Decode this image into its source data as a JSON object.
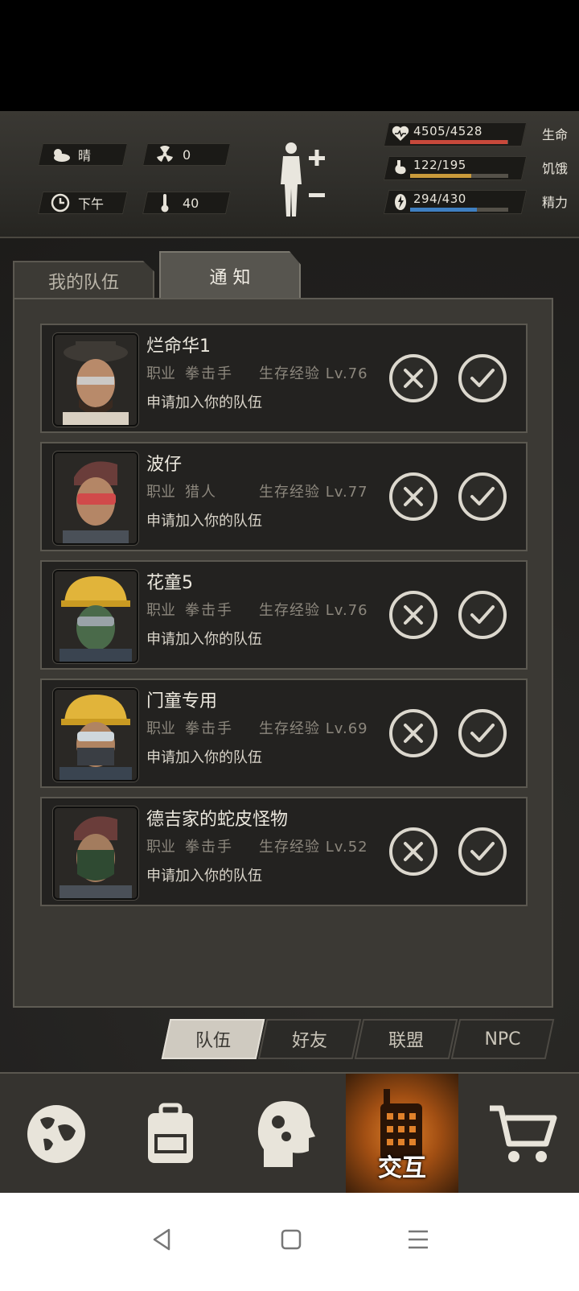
{
  "status": {
    "weather": {
      "icon": "cloud-sun-icon",
      "text": "晴"
    },
    "radiation": {
      "icon": "radiation-icon",
      "text": "0"
    },
    "time": {
      "icon": "clock-icon",
      "text": "下午"
    },
    "temperature": {
      "icon": "thermometer-icon",
      "text": "40"
    },
    "stats": [
      {
        "icon": "heart-icon",
        "text": "4505/4528",
        "label": "生命",
        "fill": 0.995,
        "color": "#c8493b"
      },
      {
        "icon": "stomach-icon",
        "text": "122/195",
        "label": "饥饿",
        "fill": 0.626,
        "color": "#c99a3a"
      },
      {
        "icon": "energy-icon",
        "text": "294/430",
        "label": "精力",
        "fill": 0.684,
        "color": "#3f7fc1"
      }
    ]
  },
  "tabs": [
    {
      "label": "我的队伍",
      "active": false
    },
    {
      "label": "通 知",
      "active": true
    }
  ],
  "job_label": "职业",
  "requests": [
    {
      "name": "烂命华1",
      "job": "拳击手",
      "exp": "生存经验 Lv.76",
      "msg": "申请加入你的队伍"
    },
    {
      "name": "波仔",
      "job": "猎人",
      "exp": "生存经验 Lv.77",
      "msg": "申请加入你的队伍"
    },
    {
      "name": "花童5",
      "job": "拳击手",
      "exp": "生存经验 Lv.76",
      "msg": "申请加入你的队伍"
    },
    {
      "name": "门童专用",
      "job": "拳击手",
      "exp": "生存经验 Lv.69",
      "msg": "申请加入你的队伍"
    },
    {
      "name": "德吉家的蛇皮怪物",
      "job": "拳击手",
      "exp": "生存经验 Lv.52",
      "msg": "申请加入你的队伍"
    }
  ],
  "subtabs": [
    {
      "label": "队伍",
      "active": true
    },
    {
      "label": "好友",
      "active": false
    },
    {
      "label": "联盟",
      "active": false
    },
    {
      "label": "NPC",
      "active": false
    }
  ],
  "bottom_nav": [
    {
      "icon": "globe-icon"
    },
    {
      "icon": "backpack-icon"
    },
    {
      "icon": "head-gears-icon"
    },
    {
      "icon": "walkie-talkie-icon",
      "label": "交互",
      "active": true
    },
    {
      "icon": "cart-icon"
    }
  ],
  "system_nav": [
    "back-icon",
    "home-icon",
    "menu-icon"
  ]
}
